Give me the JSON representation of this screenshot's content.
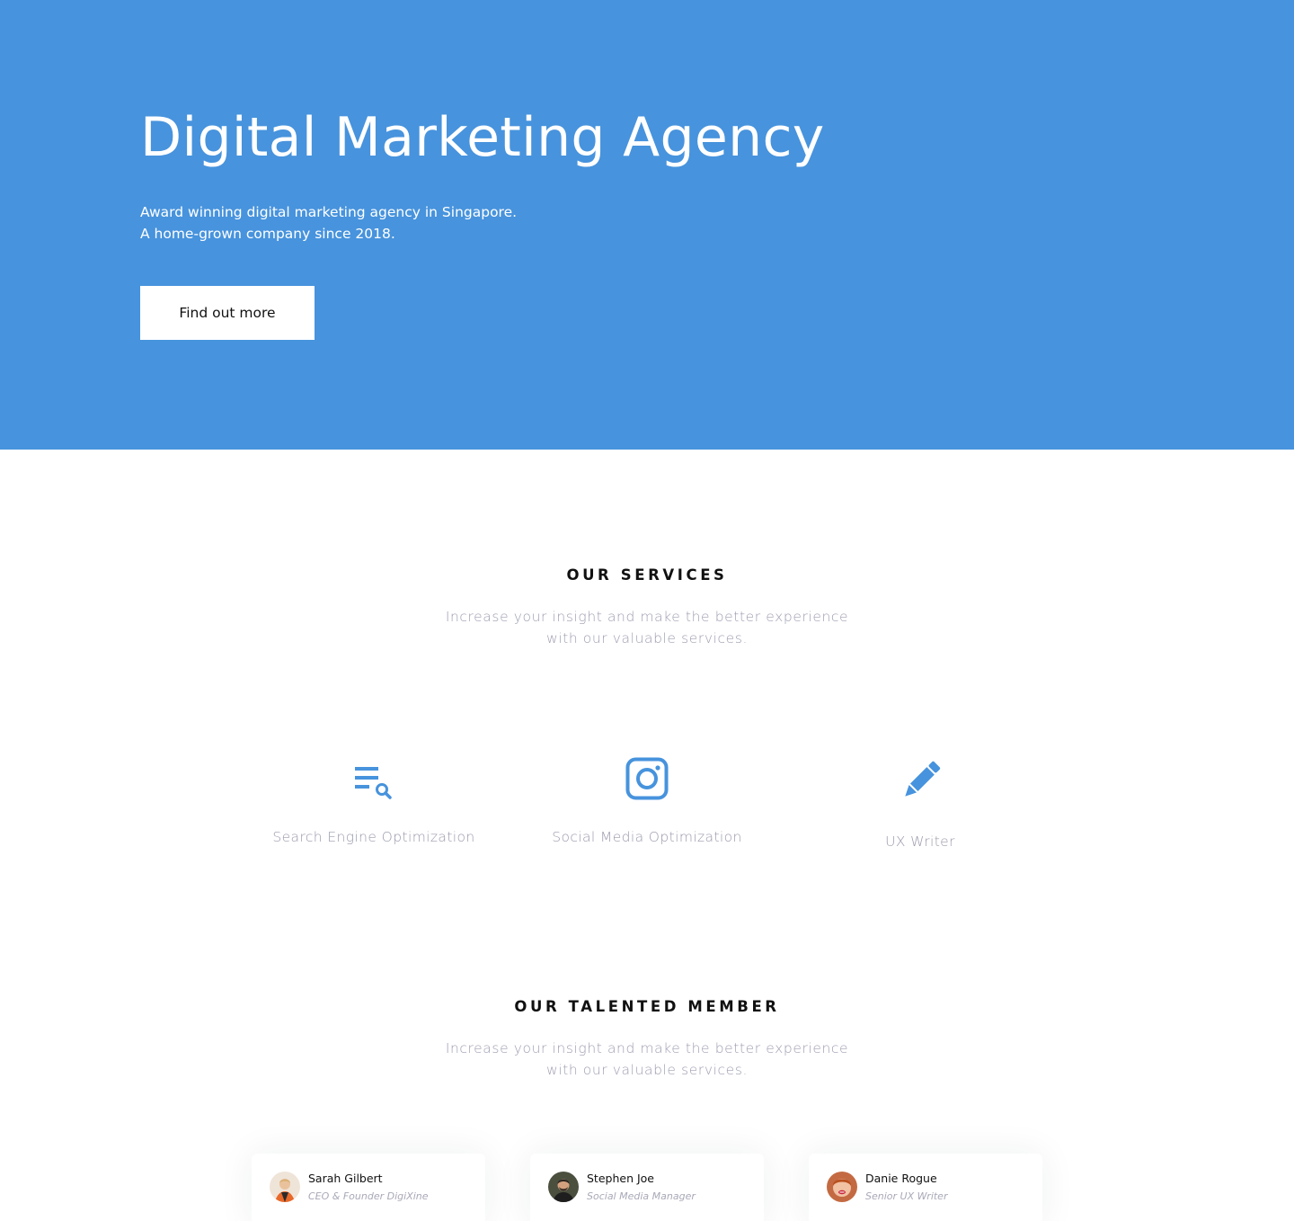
{
  "hero": {
    "title": "Digital Marketing Agency",
    "subtitle_line1": "Award winning digital marketing agency in Singapore.",
    "subtitle_line2": "A home-grown company since 2018.",
    "cta_label": "Find out more",
    "background_color": "#4793dd"
  },
  "services": {
    "heading": "OUR SERVICES",
    "sub_line1": "Increase your insight and make the better experience",
    "sub_line2": "with our  valuable services.",
    "items": [
      {
        "label": "Search Engine Optimization",
        "icon": "search-list-icon"
      },
      {
        "label": "Social Media Optimization",
        "icon": "instagram-icon"
      },
      {
        "label": "UX Writer",
        "icon": "pencil-icon"
      }
    ],
    "icon_color": "#4793dd"
  },
  "team": {
    "heading": "OUR TALENTED MEMBER",
    "sub_line1": "Increase your insight and make the better experience",
    "sub_line2": "with our  valuable services.",
    "members": [
      {
        "name": "Sarah Gilbert",
        "role": "CEO & Founder DigiXine"
      },
      {
        "name": "Stephen Joe",
        "role": "Social Media Manager"
      },
      {
        "name": "Danie Rogue",
        "role": "Senior UX Writer"
      }
    ]
  }
}
